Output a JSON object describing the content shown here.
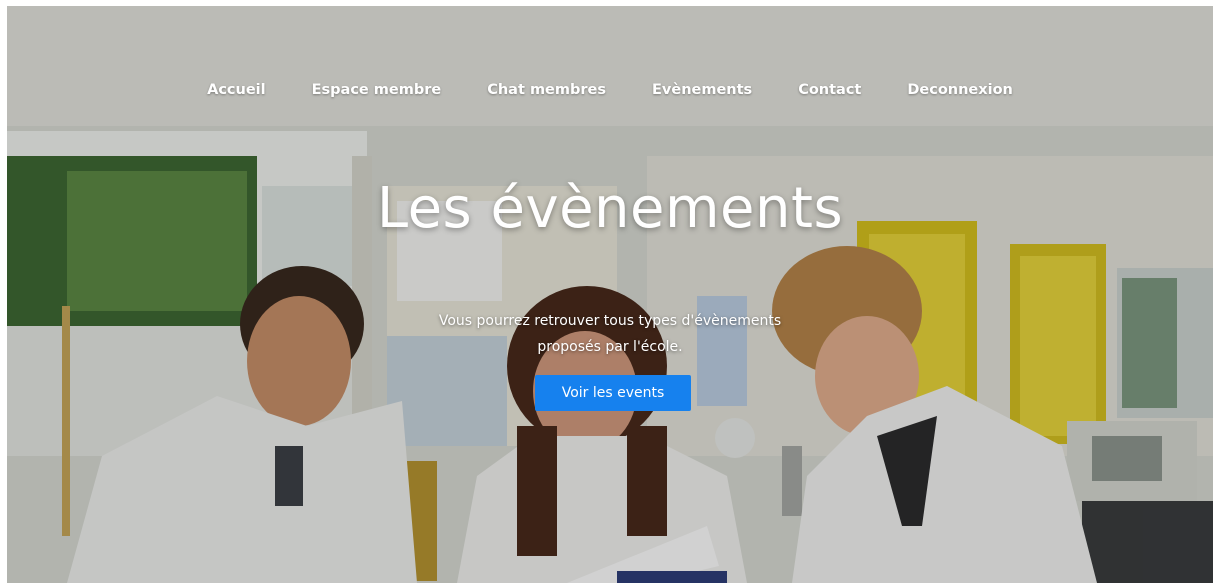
{
  "nav": {
    "items": [
      {
        "label": "Accueil"
      },
      {
        "label": "Espace membre"
      },
      {
        "label": "Chat membres"
      },
      {
        "label": "Evènements"
      },
      {
        "label": "Contact"
      },
      {
        "label": "Deconnexion"
      }
    ]
  },
  "hero": {
    "title": "Les évènements",
    "subtitle_line1": "Vous pourrez retrouver tous types d'évènements",
    "subtitle_line2": "proposés par l'école.",
    "button_label": "Voir les events",
    "button_color": "#1681ee"
  }
}
